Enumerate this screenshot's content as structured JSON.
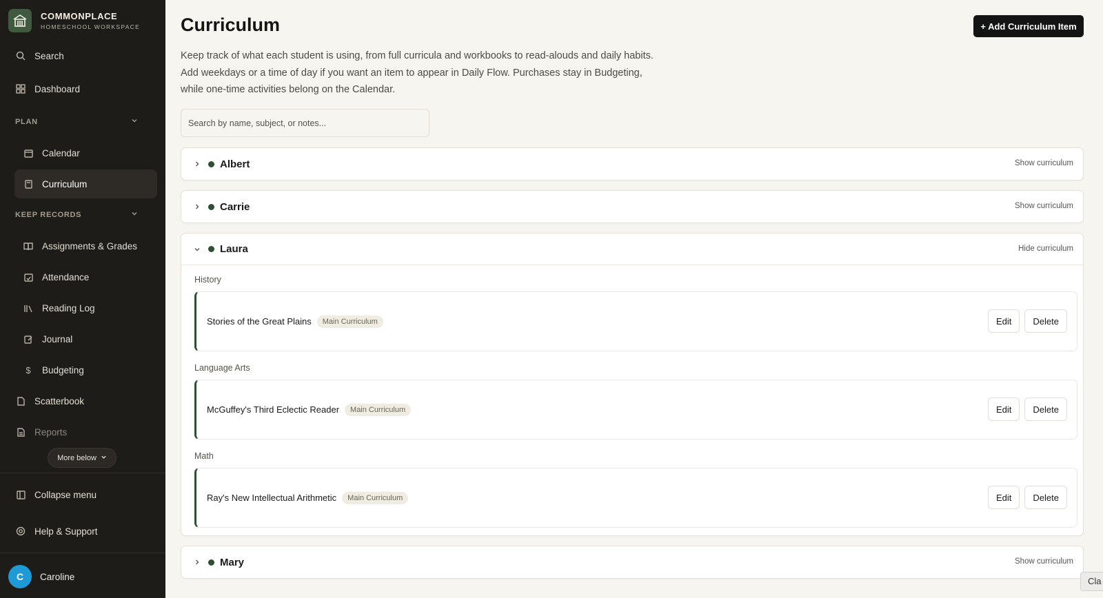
{
  "brand": {
    "name": "COMMONPLACE",
    "subtitle": "HOMESCHOOL WORKSPACE"
  },
  "sidebar": {
    "search": "Search",
    "dashboard": "Dashboard",
    "plan_section": "PLAN",
    "calendar": "Calendar",
    "curriculum": "Curriculum",
    "records_section": "KEEP RECORDS",
    "assignments": "Assignments & Grades",
    "attendance": "Attendance",
    "reading_log": "Reading Log",
    "journal": "Journal",
    "budgeting": "Budgeting",
    "scatterbook": "Scatterbook",
    "reports": "Reports",
    "more_below": "More below",
    "collapse": "Collapse menu",
    "help": "Help & Support"
  },
  "user": {
    "initial": "C",
    "name": "Caroline"
  },
  "main": {
    "title": "Curriculum",
    "add_button": "+ Add Curriculum Item",
    "description": "Keep track of what each student is using, from full curricula and workbooks to read-alouds and daily habits. Add weekdays or a time of day if you want an item to appear in Daily Flow. Purchases stay in Budgeting, while one-time activities belong on the Calendar.",
    "search_placeholder": "Search by name, subject, or notes..."
  },
  "students": [
    {
      "name": "Albert",
      "toggle": "Show curriculum"
    },
    {
      "name": "Carrie",
      "toggle": "Show curriculum"
    },
    {
      "name": "Laura",
      "toggle": "Hide curriculum",
      "groups": [
        {
          "subject": "History",
          "item": "Stories of the Great Plains",
          "badge": "Main Curriculum"
        },
        {
          "subject": "Language Arts",
          "item": "McGuffey's Third Eclectic Reader",
          "badge": "Main Curriculum"
        },
        {
          "subject": "Math",
          "item": "Ray's New Intellectual Arithmetic",
          "badge": "Main Curriculum"
        }
      ]
    },
    {
      "name": "Mary",
      "toggle": "Show curriculum"
    }
  ],
  "actions": {
    "edit": "Edit",
    "delete": "Delete"
  },
  "corner_tab": "Cla",
  "colors": {
    "sidebar_bg": "#1e1c19",
    "accent_green": "#2f4f33",
    "avatar_blue": "#1e9ad6",
    "page_bg": "#f7f5f0"
  }
}
